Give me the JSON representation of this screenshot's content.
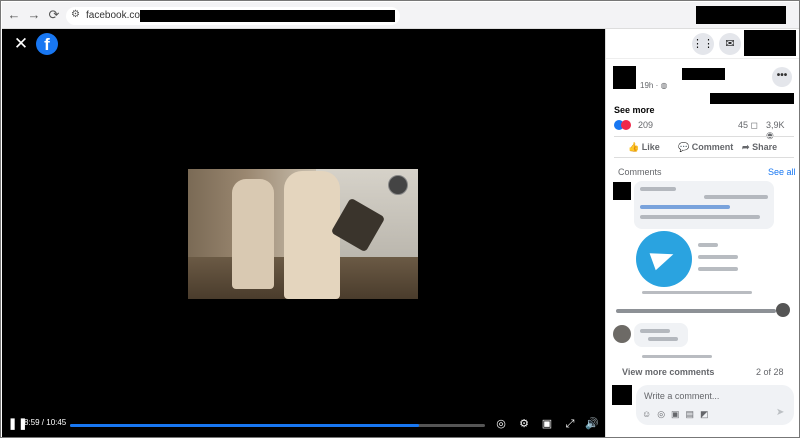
{
  "browser": {
    "back": "←",
    "forward": "→",
    "reload": "⟳",
    "url": "facebook.com/"
  },
  "video": {
    "close": "✕",
    "logo": "f",
    "time": "8:59 / 10:45",
    "progress": 0.84,
    "play_pause": "❚❚"
  },
  "post": {
    "timestamp": "19h · ◍",
    "menu": "•••",
    "see_more": "See more",
    "reaction_count": "209",
    "comment_count": "45 ◻",
    "view_count": "3,9K ◉",
    "like": "Like",
    "comment": "Comment",
    "share": "Share"
  },
  "comments": {
    "header": "Comments",
    "see_all": "See all",
    "view_more": "View more comments",
    "page_count": "2 of 28",
    "write_placeholder": "Write a comment..."
  },
  "icons": {
    "grid": "⋮⋮",
    "messenger": "✉",
    "like": "👍",
    "comment": "💬",
    "share": "➦",
    "send": "➤"
  }
}
